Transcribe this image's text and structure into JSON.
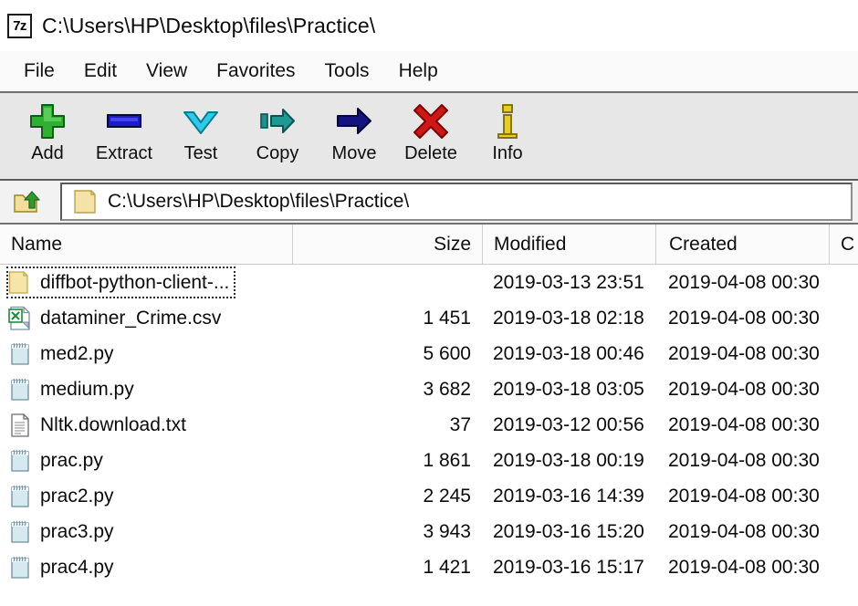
{
  "window": {
    "title": "C:\\Users\\HP\\Desktop\\files\\Practice\\",
    "app_icon_text": "7z"
  },
  "menu": {
    "items": [
      {
        "label": "File"
      },
      {
        "label": "Edit"
      },
      {
        "label": "View"
      },
      {
        "label": "Favorites"
      },
      {
        "label": "Tools"
      },
      {
        "label": "Help"
      }
    ]
  },
  "toolbar": {
    "buttons": [
      {
        "label": "Add",
        "icon": "plus-icon",
        "color": "#22a020"
      },
      {
        "label": "Extract",
        "icon": "minus-bar-icon",
        "color": "#1414c8"
      },
      {
        "label": "Test",
        "icon": "chevron-down-icon",
        "color": "#27c8e6"
      },
      {
        "label": "Copy",
        "icon": "copy-arrow-icon",
        "color": "#1d8f8f"
      },
      {
        "label": "Move",
        "icon": "move-arrow-icon",
        "color": "#12128c"
      },
      {
        "label": "Delete",
        "icon": "cross-icon",
        "color": "#cc1111"
      },
      {
        "label": "Info",
        "icon": "info-icon",
        "color": "#d9b700"
      }
    ]
  },
  "address": {
    "up_icon": "folder-up-icon",
    "folder_icon": "folder-icon",
    "path": "C:\\Users\\HP\\Desktop\\files\\Practice\\"
  },
  "columns": [
    {
      "key": "name",
      "label": "Name"
    },
    {
      "key": "size",
      "label": "Size"
    },
    {
      "key": "modified",
      "label": "Modified"
    },
    {
      "key": "created",
      "label": "Created"
    },
    {
      "key": "extra",
      "label": "C"
    }
  ],
  "files": [
    {
      "name": "diffbot-python-client-...",
      "icon": "folder-icon",
      "size": "",
      "modified": "2019-03-13 23:51",
      "created": "2019-04-08 00:30",
      "focused": true
    },
    {
      "name": "dataminer_Crime.csv",
      "icon": "spreadsheet-icon",
      "size": "1 451",
      "modified": "2019-03-18 02:18",
      "created": "2019-04-08 00:30",
      "focused": false
    },
    {
      "name": "med2.py",
      "icon": "notepad-icon",
      "size": "5 600",
      "modified": "2019-03-18 00:46",
      "created": "2019-04-08 00:30",
      "focused": false
    },
    {
      "name": "medium.py",
      "icon": "notepad-icon",
      "size": "3 682",
      "modified": "2019-03-18 03:05",
      "created": "2019-04-08 00:30",
      "focused": false
    },
    {
      "name": "Nltk.download.txt",
      "icon": "text-document-icon",
      "size": "37",
      "modified": "2019-03-12 00:56",
      "created": "2019-04-08 00:30",
      "focused": false
    },
    {
      "name": "prac.py",
      "icon": "notepad-icon",
      "size": "1 861",
      "modified": "2019-03-18 00:19",
      "created": "2019-04-08 00:30",
      "focused": false
    },
    {
      "name": "prac2.py",
      "icon": "notepad-icon",
      "size": "2 245",
      "modified": "2019-03-16 14:39",
      "created": "2019-04-08 00:30",
      "focused": false
    },
    {
      "name": "prac3.py",
      "icon": "notepad-icon",
      "size": "3 943",
      "modified": "2019-03-16 15:20",
      "created": "2019-04-08 00:30",
      "focused": false
    },
    {
      "name": "prac4.py",
      "icon": "notepad-icon",
      "size": "1 421",
      "modified": "2019-03-16 15:17",
      "created": "2019-04-08 00:30",
      "focused": false
    }
  ]
}
